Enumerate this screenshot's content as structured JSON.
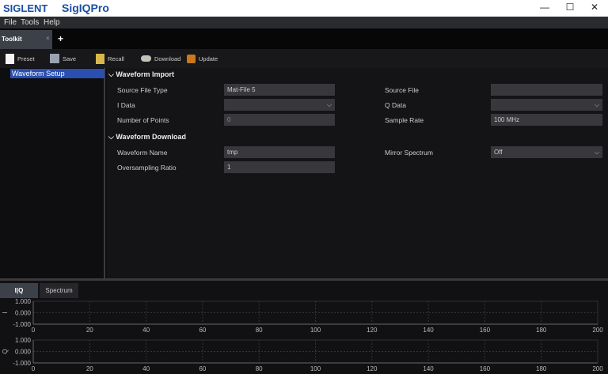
{
  "titlebar": {
    "logo": "SIGLENT",
    "app": "SigIQPro",
    "minimize": "—",
    "maximize": "☐",
    "close": "✕"
  },
  "menu": [
    "File",
    "Tools",
    "Help"
  ],
  "tabs": {
    "active": "Toolkit",
    "close": "×",
    "add": "+"
  },
  "toolbar": [
    {
      "label": "Preset",
      "icon": "page-icon"
    },
    {
      "label": "Save",
      "icon": "floppy-icon"
    },
    {
      "label": "Recall",
      "icon": "folder-icon"
    },
    {
      "label": "Download",
      "icon": "download-icon"
    },
    {
      "label": "Update",
      "icon": "update-icon"
    }
  ],
  "sidebar": {
    "items": [
      "Waveform Setup"
    ]
  },
  "import": {
    "title": "Waveform Import",
    "source_file_type_label": "Source File Type",
    "source_file_type": "Mat-File 5",
    "source_file_label": "Source File",
    "source_file": "",
    "i_data_label": "I Data",
    "i_data": "",
    "q_data_label": "Q Data",
    "q_data": "",
    "points_label": "Number of Points",
    "points": "0",
    "rate_label": "Sample Rate",
    "rate": "100 MHz"
  },
  "download": {
    "title": "Waveform Download",
    "name_label": "Waveform Name",
    "name": "tmp",
    "mirror_label": "Mirror Spectrum",
    "mirror": "Off",
    "osr_label": "Oversampling Ratio",
    "osr": "1"
  },
  "bottom_tabs": [
    "I|Q",
    "Spectrum"
  ],
  "chart_data": [
    {
      "type": "line",
      "ylabel": "I",
      "yticks": [
        "1.000",
        "0.000",
        "-1.000"
      ],
      "ylim": [
        -1,
        1
      ],
      "xlim": [
        0,
        200
      ],
      "xticks": [
        0,
        20,
        40,
        60,
        80,
        100,
        120,
        140,
        160,
        180,
        200
      ],
      "grid": true,
      "series": []
    },
    {
      "type": "line",
      "ylabel": "Q",
      "yticks": [
        "1.000",
        "0.000",
        "-1.000"
      ],
      "ylim": [
        -1,
        1
      ],
      "xlim": [
        0,
        200
      ],
      "xticks": [
        0,
        20,
        40,
        60,
        80,
        100,
        120,
        140,
        160,
        180,
        200
      ],
      "grid": true,
      "series": []
    }
  ]
}
